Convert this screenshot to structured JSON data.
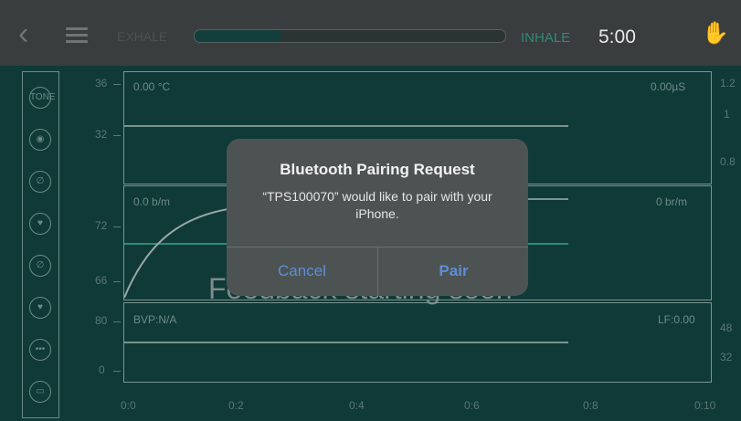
{
  "topbar": {
    "exhale_label": "EXHALE",
    "inhale_label": "INHALE",
    "timer": "5:00",
    "breath_progress": 0.28,
    "back_icon": "chevron-left-icon",
    "menu_icon": "hamburger-icon",
    "hand_icon": "hand-icon"
  },
  "sidebar": {
    "items": [
      {
        "label": "TONE",
        "icon": "tone-icon"
      },
      {
        "label": "",
        "icon": "fingerprint-icon"
      },
      {
        "label": "",
        "icon": "thermometer-off-icon"
      },
      {
        "label": "",
        "icon": "heart-off-icon"
      },
      {
        "label": "",
        "icon": "lungs-off-icon"
      },
      {
        "label": "",
        "icon": "heart-pulse-off-icon"
      },
      {
        "label": "•••",
        "icon": "more-icon"
      },
      {
        "label": "",
        "icon": "chart-icon"
      }
    ]
  },
  "panels": {
    "p1": {
      "left_label": "0.00 °C",
      "right_label": "0.00µS",
      "left_ticks": [
        "36",
        "32"
      ],
      "right_ticks": [
        "1.2",
        "1",
        "0.8"
      ]
    },
    "p2": {
      "left_label": "0.0 b/m",
      "right_label": "0 br/m",
      "left_ticks": [
        "72",
        "66"
      ]
    },
    "p3": {
      "left_label": "BVP:N/A",
      "right_label": "LF:0.00",
      "left_ticks": [
        "80",
        "0"
      ],
      "right_ticks": [
        "48",
        "32"
      ]
    }
  },
  "x_axis": [
    "0:0",
    "0:2",
    "0:4",
    "0:6",
    "0:8",
    "0:10"
  ],
  "watermark": "Feedback starting soon",
  "dialog": {
    "title": "Bluetooth Pairing Request",
    "message": "“TPS100070” would like to pair with your iPhone.",
    "cancel_label": "Cancel",
    "pair_label": "Pair"
  },
  "colors": {
    "background": "#0f3a38",
    "accent": "#2f8a77",
    "dialog_button": "#5b8fd7"
  }
}
